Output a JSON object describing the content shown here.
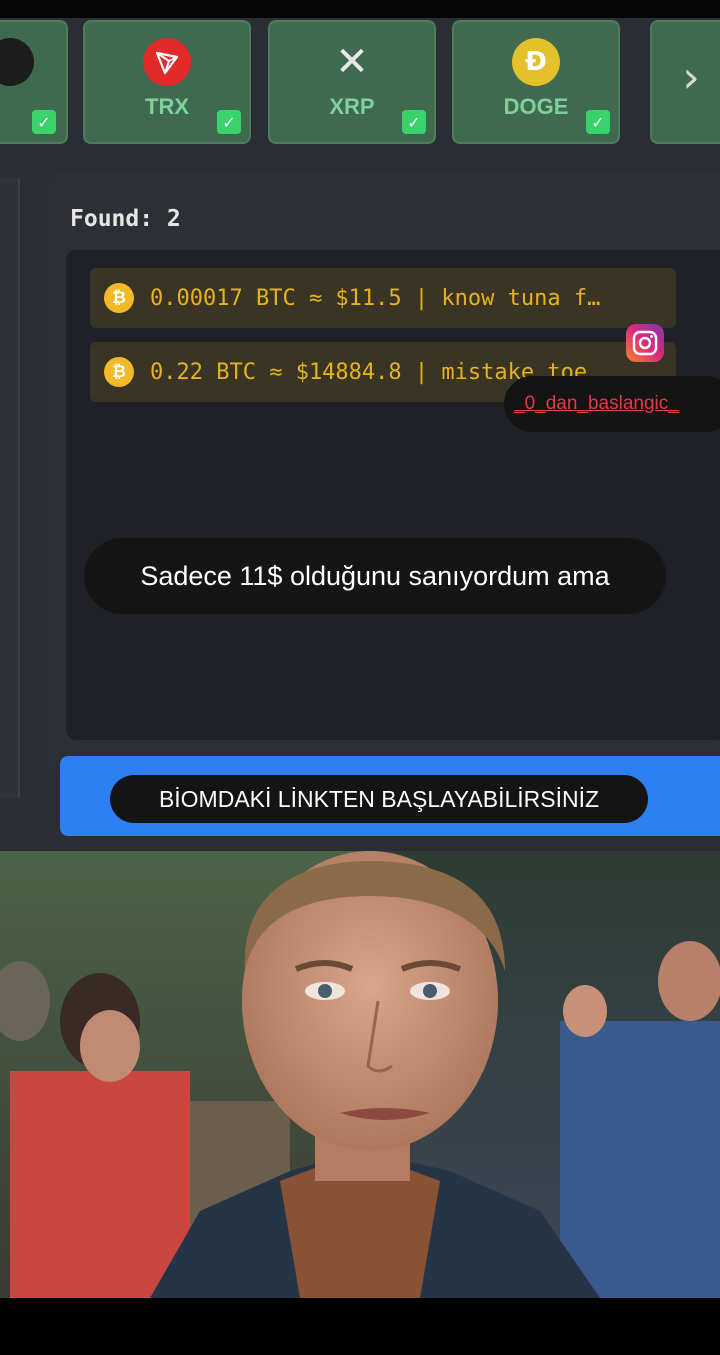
{
  "coins": [
    {
      "label": "",
      "logo": "",
      "color": "#222222",
      "checked": true
    },
    {
      "label": "TRX",
      "logo": "tron-icon",
      "color": "#e22a2a",
      "checked": true
    },
    {
      "label": "XRP",
      "logo": "xrp-icon",
      "color": "#3f6a50",
      "checked": true
    },
    {
      "label": "DOGE",
      "logo": "dogecoin-icon",
      "color": "#e4c12b",
      "checked": true
    }
  ],
  "coin_glyphs": {
    "trx": "",
    "xrp": "✕",
    "doge": "Ð"
  },
  "check_glyph": "✓",
  "next_glyph": "›",
  "found": {
    "label": "Found: 2"
  },
  "results": [
    {
      "text": "0.00017 BTC ≈ $11.5 | know tuna f…"
    },
    {
      "text": "0.22 BTC ≈ $14884.8 | mistake toe"
    }
  ],
  "btc_glyph": "₿",
  "overlay": {
    "instagram_handle": "_0_dan_baslangic_",
    "caption": "Sadece 11$ olduğunu sanıyordum ama",
    "cta": "BİOMDAKİ LİNKTEN BAŞLAYABİLİRSİNİZ"
  },
  "colors": {
    "card_green": "#3f6a50",
    "label_green": "#7fd19c",
    "check_green": "#3ad36b",
    "btc_gold": "#f2b928",
    "result_text": "#e6b21f",
    "cta_blue": "#2e7ff2",
    "handle_red": "#e23b44"
  }
}
